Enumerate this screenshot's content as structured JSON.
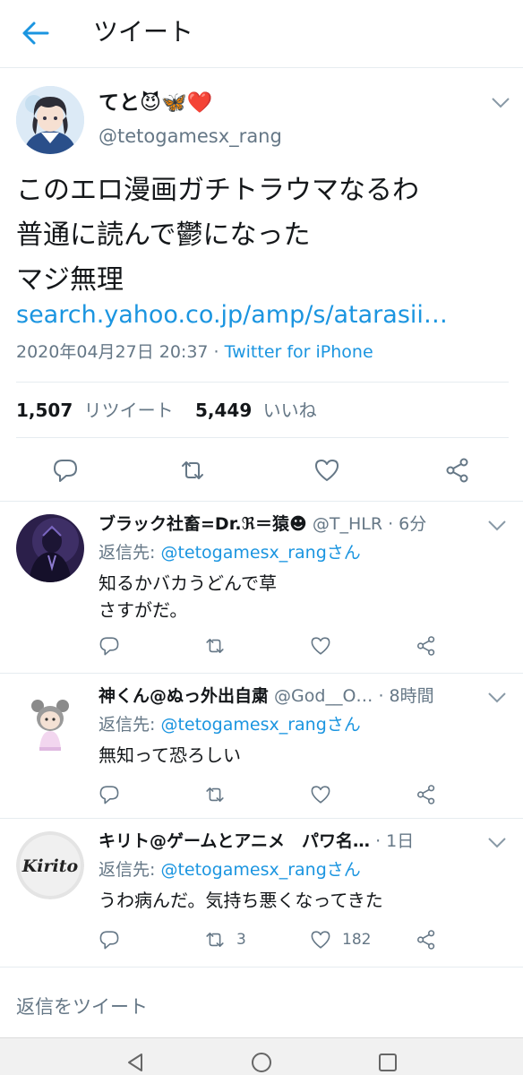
{
  "header": {
    "title": "ツイート"
  },
  "main_tweet": {
    "display_name": "てと😈🦋❤️",
    "handle": "@tetogamesx_rang",
    "text_lines": [
      "このエロ漫画ガチトラウマなるわ",
      "普通に読んで鬱になった",
      "マジ無理"
    ],
    "link": "search.yahoo.co.jp/amp/s/atarasii…",
    "timestamp": "2020年04月27日 20:37",
    "separator": " · ",
    "via": "Twitter for iPhone",
    "retweet_count": "1,507",
    "retweet_label": "リツイート",
    "like_count": "5,449",
    "like_label": "いいね"
  },
  "replies": [
    {
      "name": "ブラック社畜=Dr.ℜ＝猿☻",
      "handle_time": " @T_HLR · 6分",
      "reply_label": "返信先: ",
      "reply_to": "@tetogamesx_rangさん",
      "text_lines": [
        "知るかバカうどんで草",
        "さすがだ。"
      ],
      "retweets": "",
      "likes": ""
    },
    {
      "name": "神くん@ぬっ外出自粛",
      "handle_time": " @God__O… · 8時間",
      "reply_label": "返信先: ",
      "reply_to": "@tetogamesx_rangさん",
      "text_lines": [
        "無知って恐ろしい"
      ],
      "retweets": "",
      "likes": ""
    },
    {
      "name": "キリト@ゲームとアニメ　パワ名…",
      "handle_time": " · 1日",
      "reply_label": "返信先: ",
      "reply_to": "@tetogamesx_rangさん",
      "text_lines": [
        "うわ病んだ。気持ち悪くなってきた"
      ],
      "avatar_text": "Kirito",
      "retweets": "3",
      "likes": "182"
    }
  ],
  "compose": {
    "placeholder": "返信をツイート"
  },
  "colors": {
    "accent": "#1b95e0",
    "secondary": "#657786",
    "border": "#e6ecf0"
  }
}
